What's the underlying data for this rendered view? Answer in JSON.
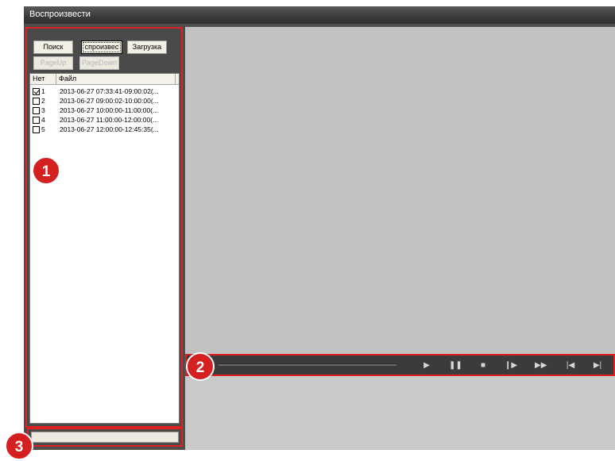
{
  "window": {
    "title": "Воспроизвести"
  },
  "toolbar": {
    "search_label": "Поиск",
    "playback_label": "спроизвес",
    "download_label": "Загрузка",
    "pageup_label": "PageUp",
    "pagedown_label": "PageDown"
  },
  "file_list": {
    "headers": {
      "num": "Нет",
      "file": "Файл"
    },
    "rows": [
      {
        "num": "1",
        "file": "2013-06-27 07:33:41-09:00:02(...",
        "checked": true
      },
      {
        "num": "2",
        "file": "2013-06-27 09:00:02-10:00:00(...",
        "checked": false
      },
      {
        "num": "3",
        "file": "2013-06-27 10:00:00-11:00:00(...",
        "checked": false
      },
      {
        "num": "4",
        "file": "2013-06-27 11:00:00-12:00:00(...",
        "checked": false
      },
      {
        "num": "5",
        "file": "2013-06-27 12:00:00-12:45:35(...",
        "checked": false
      }
    ]
  },
  "controls": [
    {
      "name": "play-icon",
      "glyph": "▶"
    },
    {
      "name": "pause-icon",
      "glyph": "❚❚"
    },
    {
      "name": "stop-icon",
      "glyph": "■"
    },
    {
      "name": "step-frame-icon",
      "glyph": "❙▶"
    },
    {
      "name": "fast-forward-icon",
      "glyph": "▶▶"
    },
    {
      "name": "previous-file-icon",
      "glyph": "|◀"
    },
    {
      "name": "next-file-icon",
      "glyph": "▶|"
    }
  ],
  "annotations": {
    "badge_1": "1",
    "badge_2": "2",
    "badge_3": "3"
  },
  "colors": {
    "highlight": "#e02020",
    "badge": "#d42020",
    "video_bg": "#c2c2c2",
    "panel_bg": "#4a4a4a"
  }
}
